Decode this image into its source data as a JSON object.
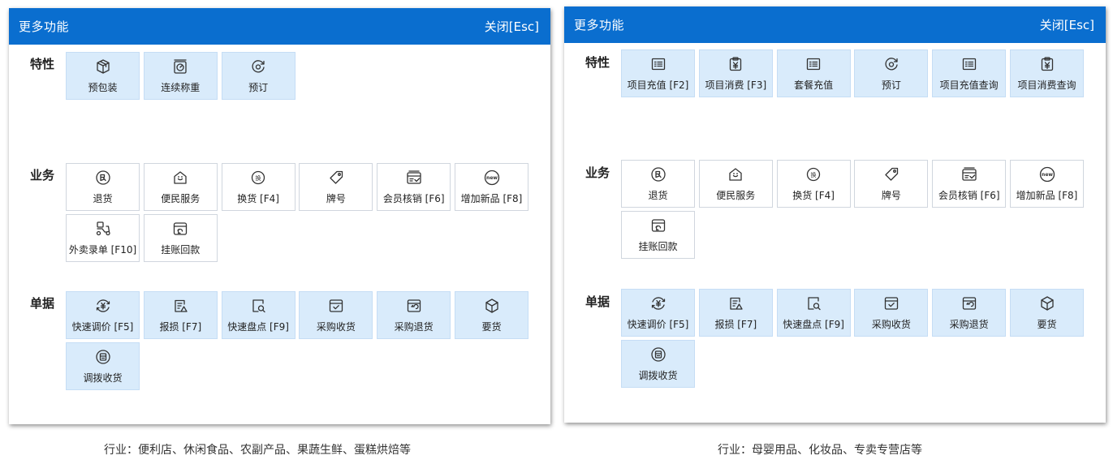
{
  "left_panel": {
    "title": "更多功能",
    "close_label": "关闭[Esc]",
    "sections": [
      {
        "label": "特性",
        "items": [
          {
            "label": "预包装",
            "icon": "package-icon",
            "highlight": true
          },
          {
            "label": "连续称重",
            "icon": "scale-icon",
            "highlight": true
          },
          {
            "label": "预订",
            "icon": "reserve-icon",
            "highlight": true
          }
        ]
      },
      {
        "label": "业务",
        "items": [
          {
            "label": "退货",
            "icon": "return-icon",
            "highlight": false
          },
          {
            "label": "便民服务",
            "icon": "house-icon",
            "highlight": false
          },
          {
            "label": "换货 [F4]",
            "icon": "exchange-icon",
            "highlight": false
          },
          {
            "label": "牌号",
            "icon": "tag-icon",
            "highlight": false
          },
          {
            "label": "会员核销 [F6]",
            "icon": "verify-card-icon",
            "highlight": false
          },
          {
            "label": "增加新品 [F8]",
            "icon": "new-badge-icon",
            "highlight": false
          },
          {
            "label": "外卖录单 [F10]",
            "icon": "scooter-icon",
            "highlight": false
          },
          {
            "label": "挂账回款",
            "icon": "receivable-icon",
            "highlight": false
          }
        ]
      },
      {
        "label": "单据",
        "items": [
          {
            "label": "快速调价 [F5]",
            "icon": "price-adjust-icon",
            "highlight": true
          },
          {
            "label": "报损 [F7]",
            "icon": "damage-report-icon",
            "highlight": true
          },
          {
            "label": "快速盘点 [F9]",
            "icon": "inventory-icon",
            "highlight": true
          },
          {
            "label": "采购收货",
            "icon": "purchase-receive-icon",
            "highlight": true
          },
          {
            "label": "采购退货",
            "icon": "purchase-return-icon",
            "highlight": true
          },
          {
            "label": "要货",
            "icon": "cube-icon",
            "highlight": true
          },
          {
            "label": "调拨收货",
            "icon": "transfer-receive-icon",
            "highlight": true
          }
        ]
      }
    ]
  },
  "right_panel": {
    "title": "更多功能",
    "close_label": "关闭[Esc]",
    "sections": [
      {
        "label": "特性",
        "items": [
          {
            "label": "项目充值 [F2]",
            "icon": "list-icon",
            "highlight": true
          },
          {
            "label": "项目消费 [F3]",
            "icon": "yuan-clipboard-icon",
            "highlight": true
          },
          {
            "label": "套餐充值",
            "icon": "list-icon",
            "highlight": true
          },
          {
            "label": "预订",
            "icon": "reserve-icon",
            "highlight": true
          },
          {
            "label": "项目充值查询",
            "icon": "list-icon",
            "highlight": true
          },
          {
            "label": "项目消费查询",
            "icon": "yuan-clipboard-icon",
            "highlight": true
          }
        ]
      },
      {
        "label": "业务",
        "items": [
          {
            "label": "退货",
            "icon": "return-icon",
            "highlight": false
          },
          {
            "label": "便民服务",
            "icon": "house-icon",
            "highlight": false
          },
          {
            "label": "换货 [F4]",
            "icon": "exchange-icon",
            "highlight": false
          },
          {
            "label": "牌号",
            "icon": "tag-icon",
            "highlight": false
          },
          {
            "label": "会员核销 [F6]",
            "icon": "verify-card-icon",
            "highlight": false
          },
          {
            "label": "增加新品 [F8]",
            "icon": "new-badge-icon",
            "highlight": false
          },
          {
            "label": "挂账回款",
            "icon": "receivable-icon",
            "highlight": false
          }
        ]
      },
      {
        "label": "单据",
        "items": [
          {
            "label": "快速调价 [F5]",
            "icon": "price-adjust-icon",
            "highlight": true
          },
          {
            "label": "报损 [F7]",
            "icon": "damage-report-icon",
            "highlight": true
          },
          {
            "label": "快速盘点 [F9]",
            "icon": "inventory-icon",
            "highlight": true
          },
          {
            "label": "采购收货",
            "icon": "purchase-receive-icon",
            "highlight": true
          },
          {
            "label": "采购退货",
            "icon": "purchase-return-icon",
            "highlight": true
          },
          {
            "label": "要货",
            "icon": "cube-icon",
            "highlight": true
          },
          {
            "label": "调拨收货",
            "icon": "transfer-receive-icon",
            "highlight": true
          }
        ]
      }
    ]
  },
  "captions": {
    "left": "行业：便利店、休闲食品、农副产品、果蔬生鲜、蛋糕烘焙等",
    "right": "行业：母婴用品、化妆品、专卖专营店等"
  },
  "colors": {
    "header": "#0a6ecf",
    "tile_highlight": "#d9ebfb",
    "icon_stroke": "#333333"
  }
}
